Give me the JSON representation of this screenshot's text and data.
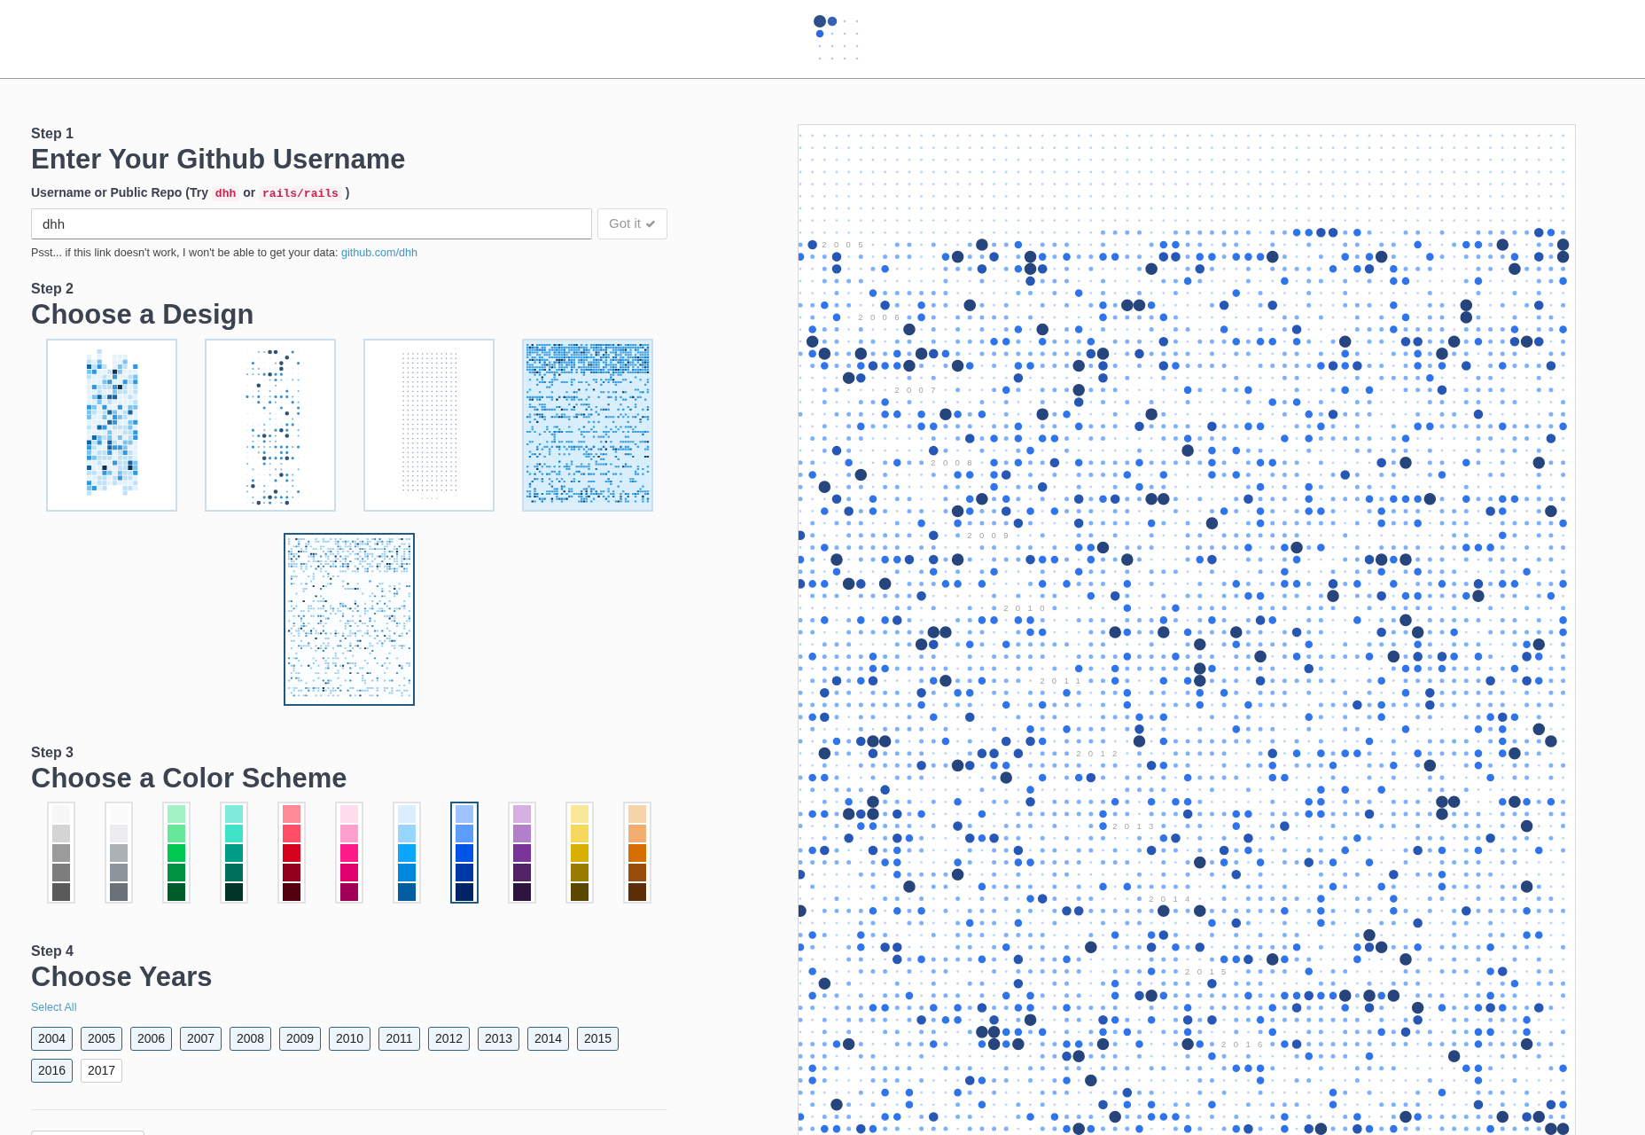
{
  "step_1": {
    "step_label": "Step 1",
    "title": "Enter Your Github Username",
    "field_label": [
      {
        "kind": "text",
        "text": "Username or Public Repo (Try"
      },
      {
        "kind": "code",
        "text": "dhh"
      },
      {
        "kind": "text",
        "text": "or"
      },
      {
        "kind": "code",
        "text": "rails/rails"
      },
      {
        "kind": "text",
        "text": ")"
      }
    ],
    "username_field": {
      "value": "dhh"
    },
    "submit_button": {
      "label": "Got it",
      "disabled": true
    },
    "hint": {
      "text": "Psst... if this link doesn't work, I won't be able to get your data:",
      "link": "github.com/dhh"
    }
  },
  "step_2": {
    "step_label": "Step 2",
    "title": "Choose a Design",
    "designs": [
      {
        "kind": "squares",
        "selected": false
      },
      {
        "kind": "dots",
        "selected": false
      },
      {
        "kind": "small-dots",
        "selected": false
      },
      {
        "kind": "dense-field",
        "selected": false
      },
      {
        "kind": "sparse-field",
        "selected": true
      }
    ]
  },
  "step_3": {
    "step_label": "Step 3",
    "title": "Choose a Color Scheme",
    "color_schemes": [
      {
        "selected": false,
        "shades": [
          {
            "color": "#f7f7f7"
          },
          {
            "color": "#d4d4d4"
          },
          {
            "color": "#9b9b9b"
          },
          {
            "color": "#7d7d7d"
          },
          {
            "color": "#5a5a5a"
          }
        ]
      },
      {
        "selected": false,
        "shades": [
          {
            "color": "#fbfbfb"
          },
          {
            "color": "#ededef"
          },
          {
            "color": "#acb1b5"
          },
          {
            "color": "#8c959b"
          },
          {
            "color": "#6a7177"
          }
        ]
      },
      {
        "selected": false,
        "shades": [
          {
            "color": "#a2f2c5"
          },
          {
            "color": "#66e89b"
          },
          {
            "color": "#00c853"
          },
          {
            "color": "#00923f"
          },
          {
            "color": "#005c28"
          }
        ]
      },
      {
        "selected": false,
        "shades": [
          {
            "color": "#81ebdb"
          },
          {
            "color": "#40e3c8"
          },
          {
            "color": "#009e86"
          },
          {
            "color": "#006f5b"
          },
          {
            "color": "#003529"
          }
        ]
      },
      {
        "selected": false,
        "shades": [
          {
            "color": "#ff8a98"
          },
          {
            "color": "#ff4d66"
          },
          {
            "color": "#d5001c"
          },
          {
            "color": "#92001b"
          },
          {
            "color": "#520010"
          }
        ]
      },
      {
        "selected": false,
        "shades": [
          {
            "color": "#ffdcec"
          },
          {
            "color": "#ff9fce"
          },
          {
            "color": "#ff1a8b"
          },
          {
            "color": "#e0006f"
          },
          {
            "color": "#a00055"
          }
        ]
      },
      {
        "selected": false,
        "shades": [
          {
            "color": "#daeeff"
          },
          {
            "color": "#99d6ff"
          },
          {
            "color": "#0da6ff"
          },
          {
            "color": "#0088e0"
          },
          {
            "color": "#005d9f"
          }
        ]
      },
      {
        "selected": true,
        "shades": [
          {
            "color": "#9ec3ff"
          },
          {
            "color": "#5c9cff"
          },
          {
            "color": "#0055e8"
          },
          {
            "color": "#003aa8"
          },
          {
            "color": "#002466"
          }
        ]
      },
      {
        "selected": false,
        "shades": [
          {
            "color": "#d6b0e0"
          },
          {
            "color": "#b17fcc"
          },
          {
            "color": "#7b3499"
          },
          {
            "color": "#542268"
          },
          {
            "color": "#2e1540"
          }
        ]
      },
      {
        "selected": false,
        "shades": [
          {
            "color": "#fae89a"
          },
          {
            "color": "#f5d75c"
          },
          {
            "color": "#d9b000"
          },
          {
            "color": "#9c7c00"
          },
          {
            "color": "#5a4700"
          }
        ]
      },
      {
        "selected": false,
        "shades": [
          {
            "color": "#f7d3ab"
          },
          {
            "color": "#f2ae6e"
          },
          {
            "color": "#d66e00"
          },
          {
            "color": "#9a4d0b"
          },
          {
            "color": "#5c2d08"
          }
        ]
      }
    ]
  },
  "step_4": {
    "step_label": "Step 4",
    "title": "Choose Years",
    "select_all": "Select All",
    "years": [
      {
        "label": "2004",
        "selected": true
      },
      {
        "label": "2005",
        "selected": true
      },
      {
        "label": "2006",
        "selected": true
      },
      {
        "label": "2007",
        "selected": true
      },
      {
        "label": "2008",
        "selected": true
      },
      {
        "label": "2009",
        "selected": true
      },
      {
        "label": "2010",
        "selected": true
      },
      {
        "label": "2011",
        "selected": true
      },
      {
        "label": "2012",
        "selected": true
      },
      {
        "label": "2013",
        "selected": true
      },
      {
        "label": "2014",
        "selected": true
      },
      {
        "label": "2015",
        "selected": true
      },
      {
        "label": "2016",
        "selected": true
      },
      {
        "label": "2017",
        "selected": false
      }
    ]
  },
  "poster": {
    "year_labels": [
      "2005",
      "2006",
      "2007",
      "2008",
      "2009",
      "2010",
      "2011",
      "2012",
      "2013",
      "2014",
      "2015",
      "2016"
    ]
  }
}
